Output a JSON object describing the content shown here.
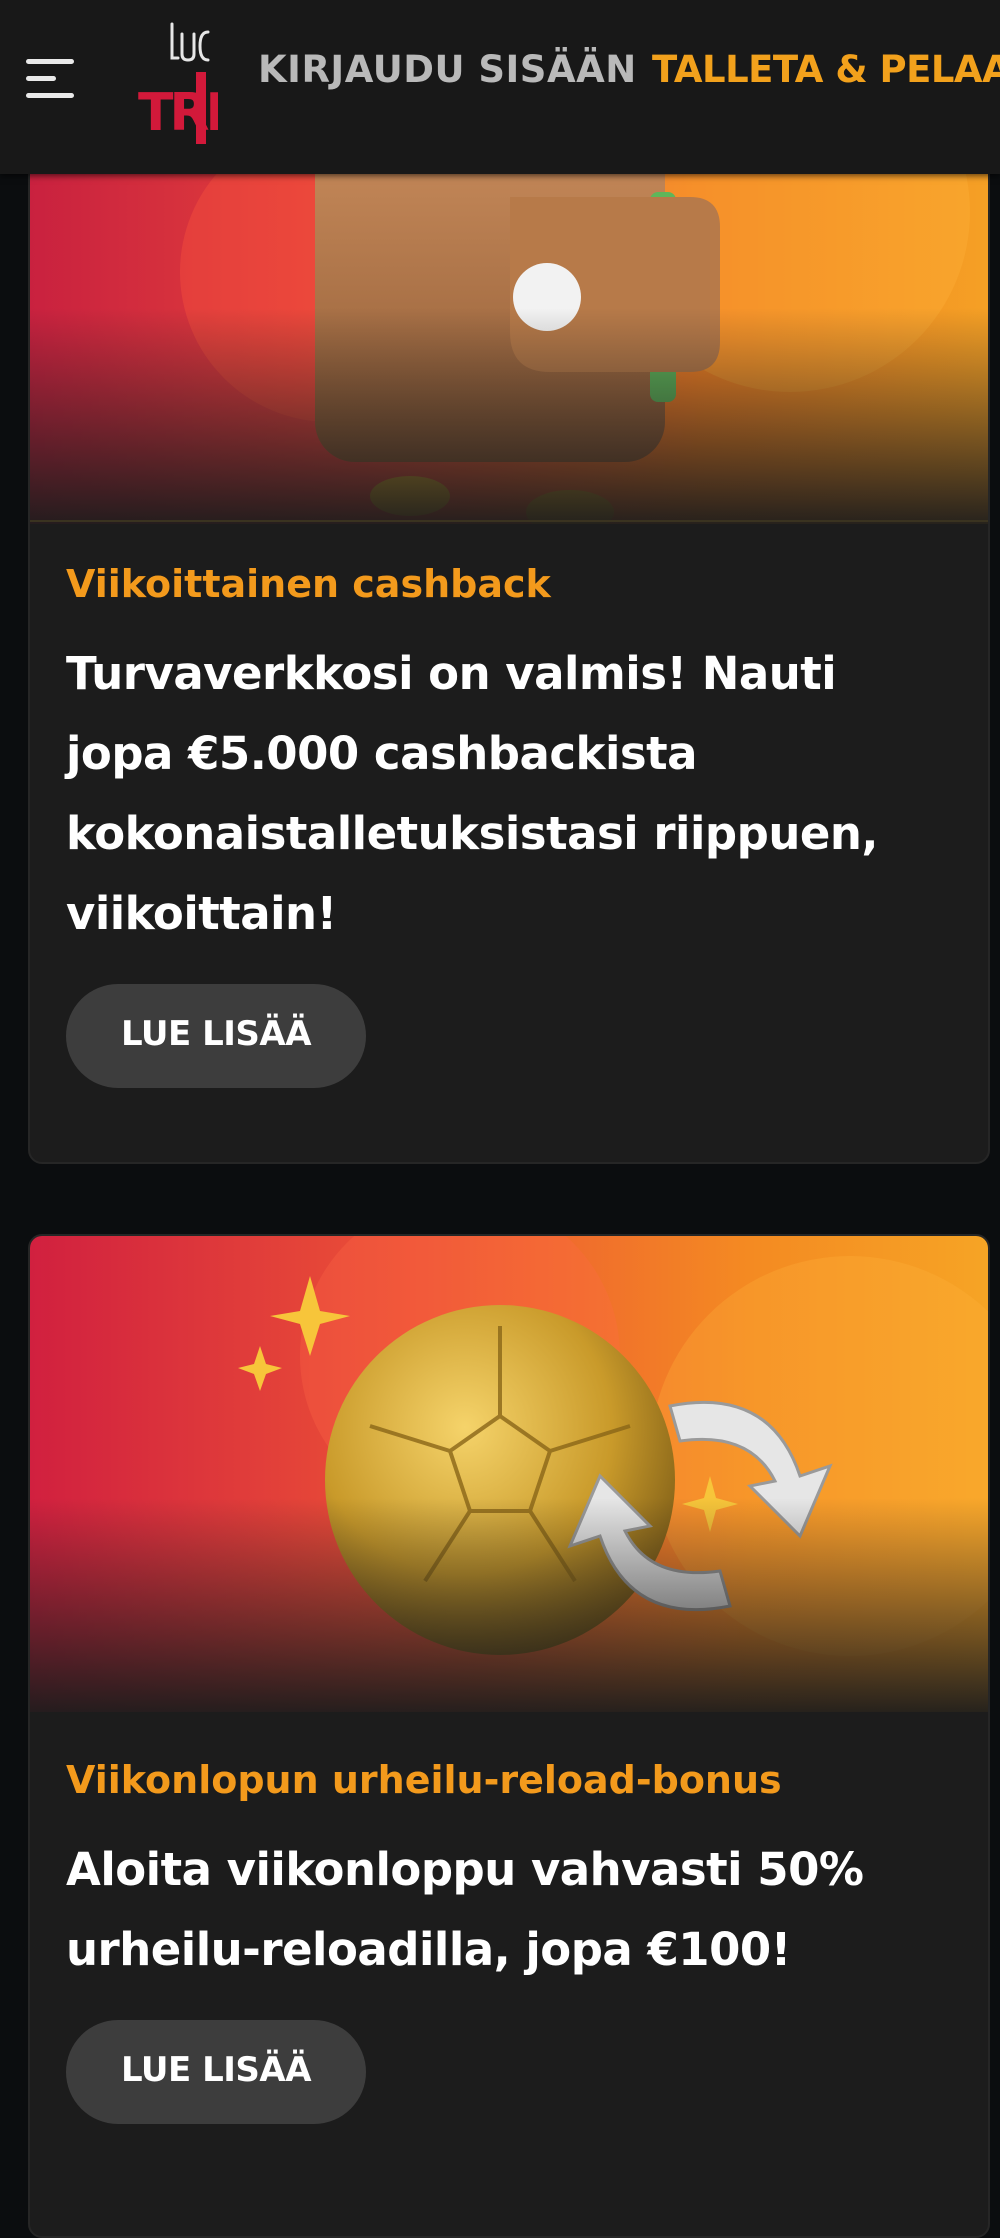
{
  "header": {
    "menu_icon": "hamburger-menu-icon",
    "logo_text_top": "LUCKY",
    "logo_text_bottom": "TRI",
    "login_label": "KIRJAUDU SISÄÄN",
    "deposit_label": "TALLETA & PELAA"
  },
  "colors": {
    "background": "#0b0d0f",
    "header": "#181818",
    "card": "#1c1c1c",
    "accent_orange": "#f39a1c",
    "nav_gray": "#b9b9b9",
    "button": "#3d3d3d",
    "logo_red": "#d2193a"
  },
  "promos": [
    {
      "image_icon": "wallet-with-coins-icon",
      "tag": "Viikoittainen cashback",
      "text": "Turvaverkkosi on valmis! Nauti jopa €5.000 cashbackista kokonaistalletuksistasi riippuen, viikoittain!",
      "button_label": "LUE LISÄÄ"
    },
    {
      "image_icon": "golden-football-reload-icon",
      "tag": "Viikonlopun urheilu-reload-bonus",
      "text": "Aloita viikonloppu vahvasti 50% urheilu-reloadilla, jopa €100!",
      "button_label": "LUE LISÄÄ"
    }
  ]
}
